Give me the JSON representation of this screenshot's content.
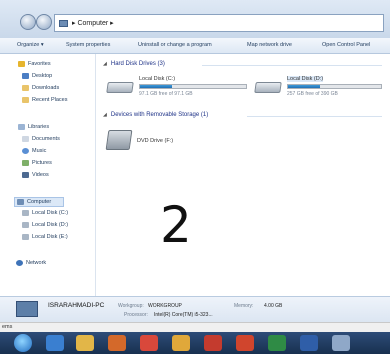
{
  "window": {
    "address_path": "▸  Computer  ▸"
  },
  "commands": [
    {
      "label": "Organize ▾"
    },
    {
      "label": "System properties"
    },
    {
      "label": "Uninstall or change a program"
    },
    {
      "label": "Map network drive"
    },
    {
      "label": "Open Control Panel"
    }
  ],
  "sidebar": {
    "favorites_label": "Favorites",
    "favorites": [
      "Desktop",
      "Downloads",
      "Recent Places"
    ],
    "libraries_label": "Libraries",
    "libraries": [
      "Documents",
      "Music",
      "Pictures",
      "Videos"
    ],
    "computer_label": "Computer",
    "drives": [
      "Local Disk (C:)",
      "Local Disk (D:)",
      "Local Disk (E:)"
    ],
    "network_label": "Network"
  },
  "main": {
    "hdd_group": "Hard Disk Drives (3)",
    "removable_group": "Devices with Removable Storage (1)",
    "drives": [
      {
        "name": "Local Disk (C:)",
        "free": "97.1 GB free of 97.1 GB",
        "used_fraction": 0.3
      },
      {
        "name": "Local Disk (D:)",
        "free": "257 GB free of 390 GB",
        "used_fraction": 0.34
      }
    ],
    "dvd": {
      "name": "DVD Drive (F:)"
    }
  },
  "overlay": {
    "text": "2"
  },
  "details": {
    "pc_name": "ISRARAHMADI-PC",
    "workgroup_label": "Workgroup:",
    "workgroup": "WORKGROUP",
    "memory_label": "Memory:",
    "memory": "4.00 GB",
    "processor_label": "Processor:",
    "processor": "Intel(R) Core(TM) i5-323..."
  },
  "status": {
    "text": "ems"
  },
  "colors": {
    "accent": "#1f6fb5",
    "taskbar": "#18304f"
  }
}
